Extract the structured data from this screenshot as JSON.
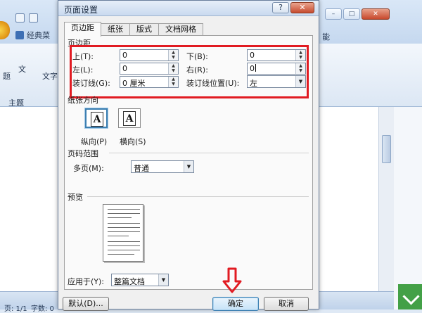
{
  "background": {
    "tab_label": "经典菜",
    "ribbon": {
      "item1": "题",
      "item2": "文",
      "item3": "文字",
      "group": "主题"
    },
    "right_tab": "能",
    "status": {
      "page": "页: 1/1",
      "words": "字数: 0"
    }
  },
  "dialog": {
    "title": "页面设置",
    "help_glyph": "?",
    "close_glyph": "✕",
    "tabs": [
      "页边距",
      "纸张",
      "版式",
      "文档网格"
    ],
    "margins": {
      "group_label": "页边距",
      "top_label": "上(T):",
      "top_value": "0",
      "bottom_label": "下(B):",
      "bottom_value": "0",
      "left_label": "左(L):",
      "left_value": "0",
      "right_label": "右(R):",
      "right_value": "0",
      "gutter_label": "装订线(G):",
      "gutter_value": "0 厘米",
      "gutter_pos_label": "装订线位置(U):",
      "gutter_pos_value": "左"
    },
    "orientation": {
      "group_label": "纸张方向",
      "portrait_label": "纵向(P)",
      "landscape_label": "横向(S)",
      "glyph": "A"
    },
    "pages": {
      "group_label": "页码范围",
      "multiple_label": "多页(M):",
      "multiple_value": "普通"
    },
    "preview": {
      "group_label": "预览"
    },
    "apply": {
      "label": "应用于(Y):",
      "value": "整篇文档"
    },
    "buttons": {
      "default": "默认(D)...",
      "ok": "确定",
      "cancel": "取消"
    }
  },
  "colors": {
    "highlight": "#e11b22",
    "accent": "#3c7fb1"
  }
}
